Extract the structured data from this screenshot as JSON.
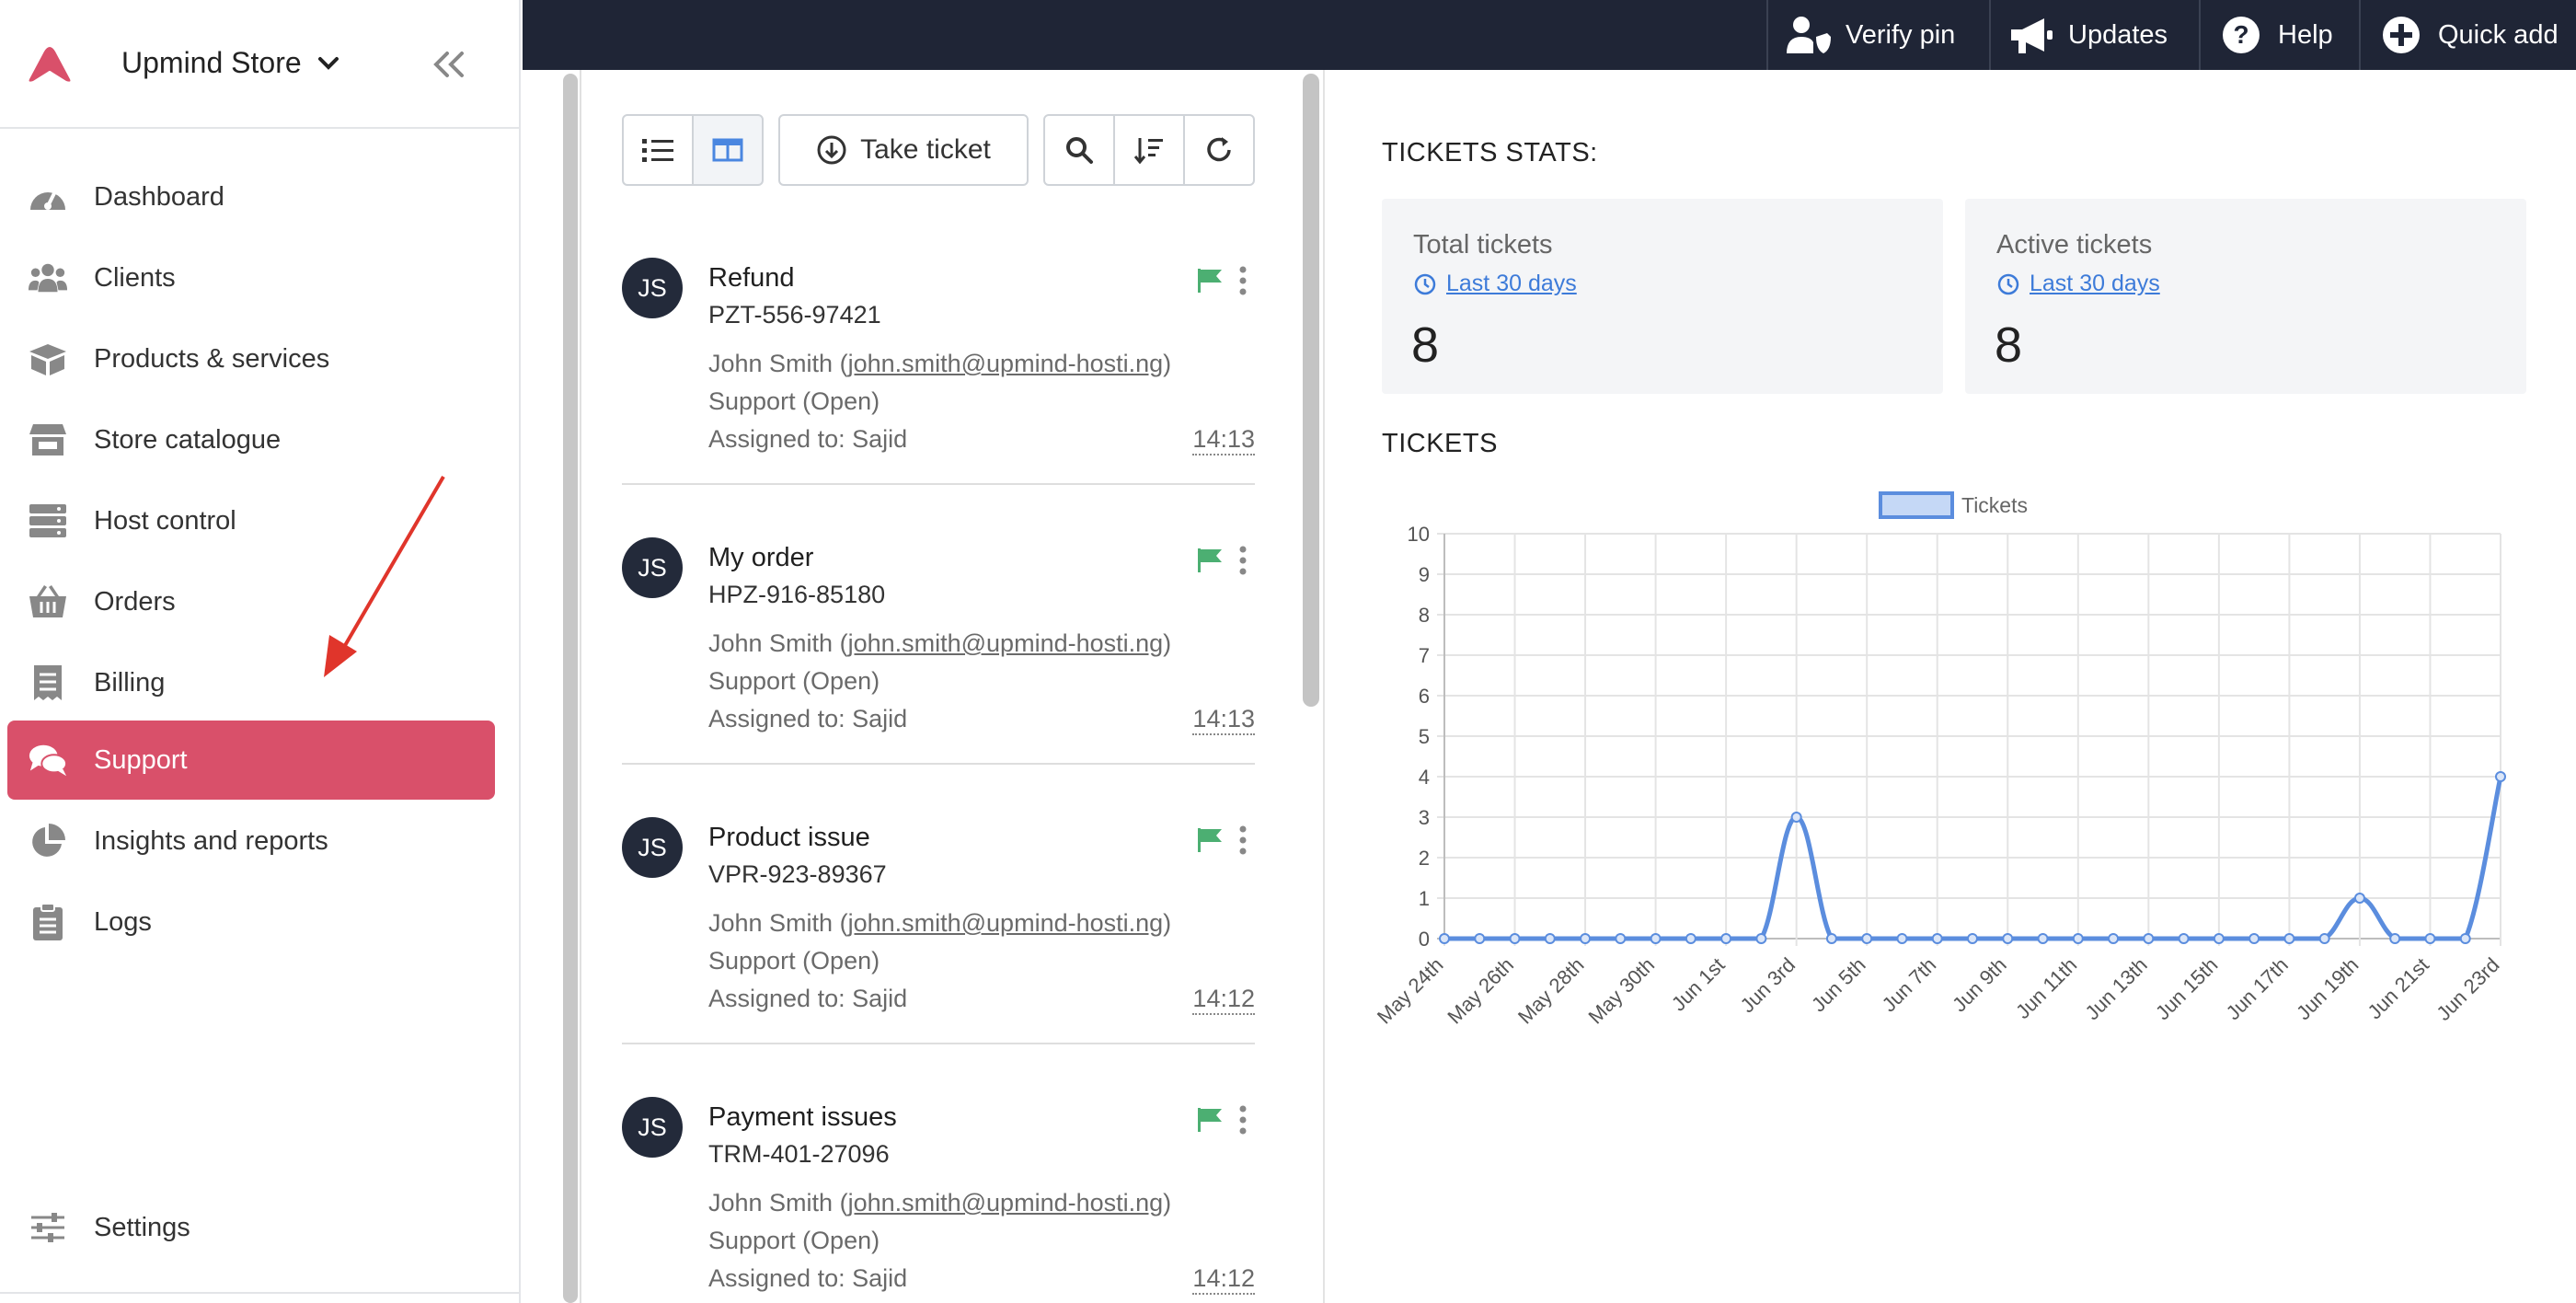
{
  "brand": {
    "store_name": "Upmind Store",
    "logo_color": "#d9506a"
  },
  "sidebar": {
    "items": [
      {
        "label": "Dashboard",
        "icon": "gauge-icon",
        "active": false
      },
      {
        "label": "Clients",
        "icon": "users-icon",
        "active": false
      },
      {
        "label": "Products & services",
        "icon": "box-icon",
        "active": false
      },
      {
        "label": "Store catalogue",
        "icon": "store-icon",
        "active": false
      },
      {
        "label": "Host control",
        "icon": "server-icon",
        "active": false
      },
      {
        "label": "Orders",
        "icon": "basket-icon",
        "active": false
      },
      {
        "label": "Billing",
        "icon": "receipt-icon",
        "active": false
      },
      {
        "label": "Support",
        "icon": "chat-icon",
        "active": true
      },
      {
        "label": "Insights and reports",
        "icon": "pie-chart-icon",
        "active": false
      },
      {
        "label": "Logs",
        "icon": "clipboard-icon",
        "active": false
      }
    ],
    "settings_label": "Settings",
    "active_color": "#d9506a"
  },
  "topbar": {
    "verify_pin": "Verify pin",
    "updates": "Updates",
    "help": "Help",
    "quick_add": "Quick add",
    "background": "#1f2536"
  },
  "toolbar": {
    "take_ticket": "Take ticket"
  },
  "tickets": [
    {
      "initials": "JS",
      "title": "Refund",
      "code": "PZT-556-97421",
      "name": "John Smith",
      "email": "john.smith@upmind-hosti.ng",
      "status": "Support (Open)",
      "assigned": "Assigned to: Sajid",
      "time": "14:13"
    },
    {
      "initials": "JS",
      "title": "My order",
      "code": "HPZ-916-85180",
      "name": "John Smith",
      "email": "john.smith@upmind-hosti.ng",
      "status": "Support (Open)",
      "assigned": "Assigned to: Sajid",
      "time": "14:13"
    },
    {
      "initials": "JS",
      "title": "Product issue",
      "code": "VPR-923-89367",
      "name": "John Smith",
      "email": "john.smith@upmind-hosti.ng",
      "status": "Support (Open)",
      "assigned": "Assigned to: Sajid",
      "time": "14:12"
    },
    {
      "initials": "JS",
      "title": "Payment issues",
      "code": "TRM-401-27096",
      "name": "John Smith",
      "email": "john.smith@upmind-hosti.ng",
      "status": "Support (Open)",
      "assigned": "Assigned to: Sajid",
      "time": "14:12"
    }
  ],
  "stats": {
    "heading": "TICKETS STATS:",
    "cards": [
      {
        "label": "Total tickets",
        "period": "Last 30 days",
        "value": "8"
      },
      {
        "label": "Active tickets",
        "period": "Last 30 days",
        "value": "8"
      }
    ],
    "chart_heading": "TICKETS"
  },
  "chart_data": {
    "type": "line",
    "title": "",
    "xlabel": "",
    "ylabel": "",
    "ylim": [
      0,
      10
    ],
    "grid": true,
    "legend_position": "top-center",
    "x_tick_labels": [
      "May 24th",
      "May 26th",
      "May 28th",
      "May 30th",
      "Jun 1st",
      "Jun 3rd",
      "Jun 5th",
      "Jun 7th",
      "Jun 9th",
      "Jun 11th",
      "Jun 13th",
      "Jun 15th",
      "Jun 17th",
      "Jun 19th",
      "Jun 21st",
      "Jun 23rd"
    ],
    "x": [
      "May 24th",
      "May 25th",
      "May 26th",
      "May 27th",
      "May 28th",
      "May 29th",
      "May 30th",
      "May 31st",
      "Jun 1st",
      "Jun 2nd",
      "Jun 3rd",
      "Jun 4th",
      "Jun 5th",
      "Jun 6th",
      "Jun 7th",
      "Jun 8th",
      "Jun 9th",
      "Jun 10th",
      "Jun 11th",
      "Jun 12th",
      "Jun 13th",
      "Jun 14th",
      "Jun 15th",
      "Jun 16th",
      "Jun 17th",
      "Jun 18th",
      "Jun 19th",
      "Jun 20th",
      "Jun 21st",
      "Jun 22nd",
      "Jun 23rd"
    ],
    "series": [
      {
        "name": "Tickets",
        "color": "#5b8dde",
        "values": [
          0,
          0,
          0,
          0,
          0,
          0,
          0,
          0,
          0,
          0,
          3,
          0,
          0,
          0,
          0,
          0,
          0,
          0,
          0,
          0,
          0,
          0,
          0,
          0,
          0,
          0,
          1,
          0,
          0,
          0,
          4
        ]
      }
    ]
  }
}
